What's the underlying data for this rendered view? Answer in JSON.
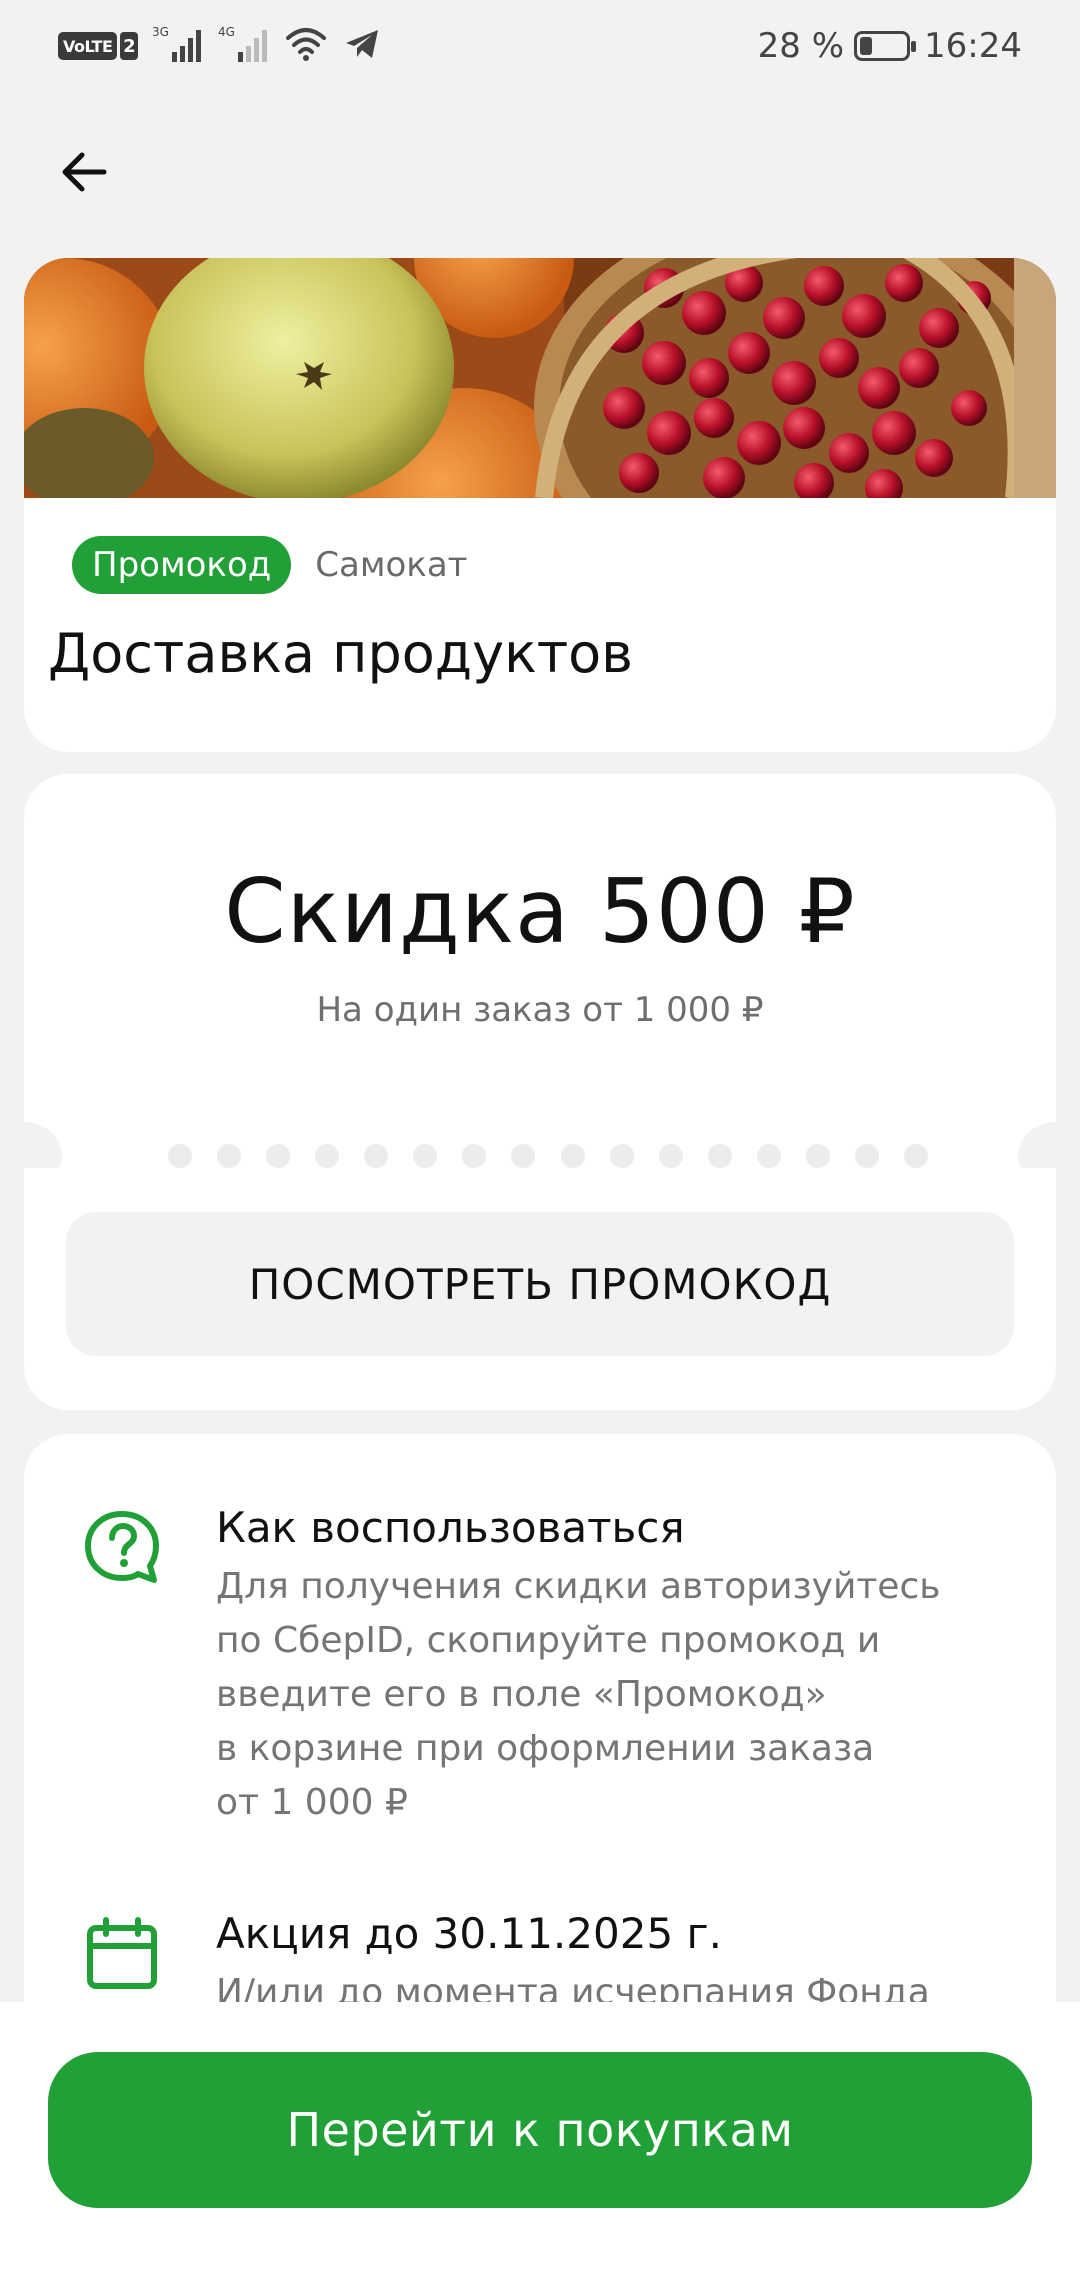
{
  "colors": {
    "accent": "#21a038",
    "background": "#f2f2f2",
    "card": "#ffffff"
  },
  "status_bar": {
    "network_label": "VoLTE",
    "network_sim": "2",
    "net_3g": "3G",
    "net_4g": "4G",
    "battery_percent": "28 %",
    "battery_level": 0.28,
    "time": "16:24",
    "icons": [
      "volte-icon",
      "signal-3g-icon",
      "signal-4g-icon",
      "wifi-icon",
      "telegram-icon",
      "battery-icon"
    ]
  },
  "header": {
    "back_icon": "arrow-left-icon",
    "promo_badge": "Промокод",
    "brand": "Самокат",
    "title": "Доставка продуктов"
  },
  "discount": {
    "title": "Скидка 500 ₽",
    "subtitle": "На один заказ от 1 000 ₽",
    "show_button": "ПОСМОТРЕТЬ ПРОМОКОД"
  },
  "info": {
    "how_to": {
      "icon": "question-chat-icon",
      "heading": "Как воспользоваться",
      "lines": [
        "Для получения скидки авторизуйтесь",
        "по СберID, скопируйте промокод и",
        "введите его в поле «Промокод»",
        "в корзине при оформлении заказа",
        "от 1 000 ₽"
      ]
    },
    "period": {
      "icon": "calendar-icon",
      "heading": "Акция до 30.11.2025 г.",
      "body": "И/или до момента исчерпания Фонда"
    }
  },
  "footer": {
    "go_button": "Перейти к покупкам"
  }
}
